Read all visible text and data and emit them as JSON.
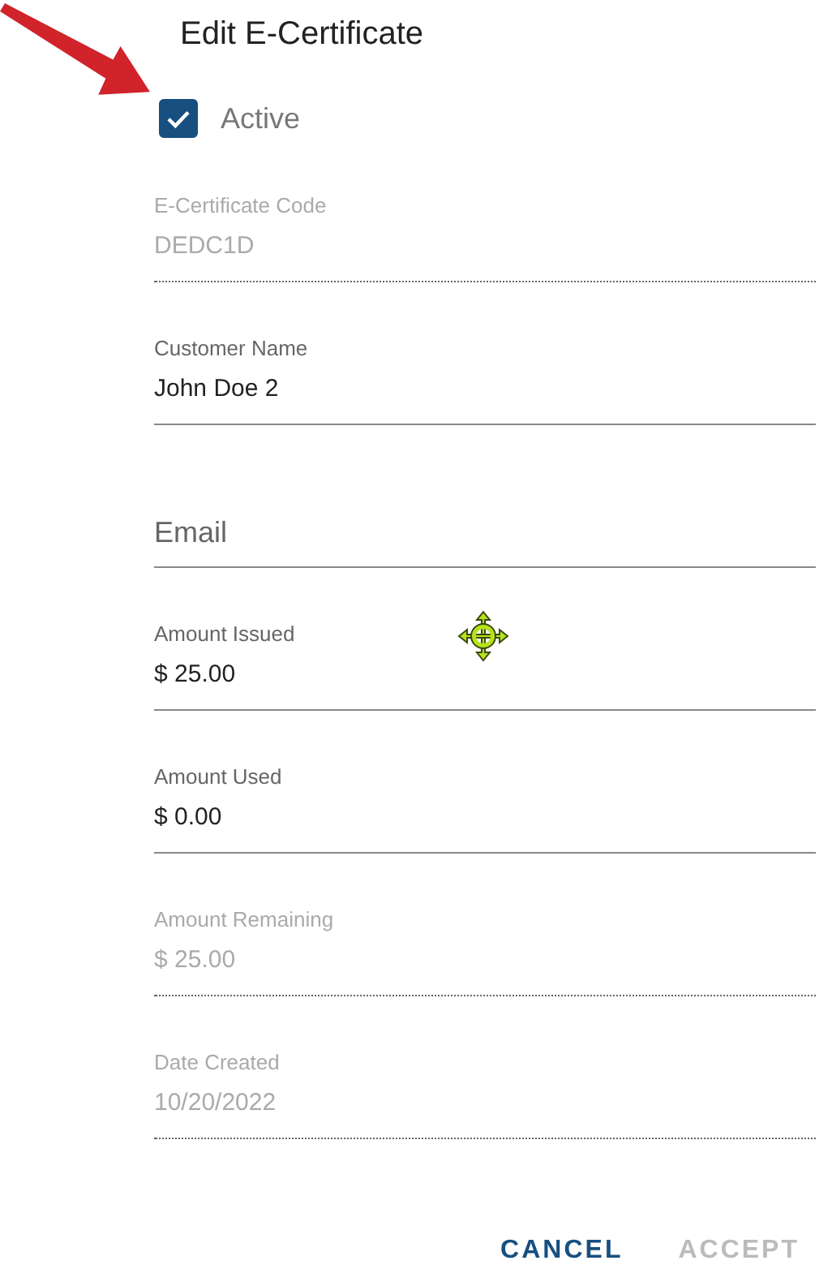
{
  "dialog": {
    "title": "Edit E-Certificate"
  },
  "active": {
    "label": "Active",
    "checked": true
  },
  "fields": [
    {
      "label": "E-Certificate Code",
      "value": "DEDC1D",
      "disabled": true
    },
    {
      "label": "Customer Name",
      "value": "John Doe 2",
      "disabled": false
    },
    {
      "placeholder": "Email",
      "disabled": false
    },
    {
      "label": "Amount Issued",
      "value": "$ 25.00",
      "disabled": false
    },
    {
      "label": "Amount Used",
      "value": "$ 0.00",
      "disabled": false
    },
    {
      "label": "Amount Remaining",
      "value": "$ 25.00",
      "disabled": true
    },
    {
      "label": "Date Created",
      "value": "10/20/2022",
      "disabled": true
    }
  ],
  "buttons": [
    {
      "label": "CANCEL",
      "disabled": false
    },
    {
      "label": "ACCEPT",
      "disabled": true
    }
  ]
}
